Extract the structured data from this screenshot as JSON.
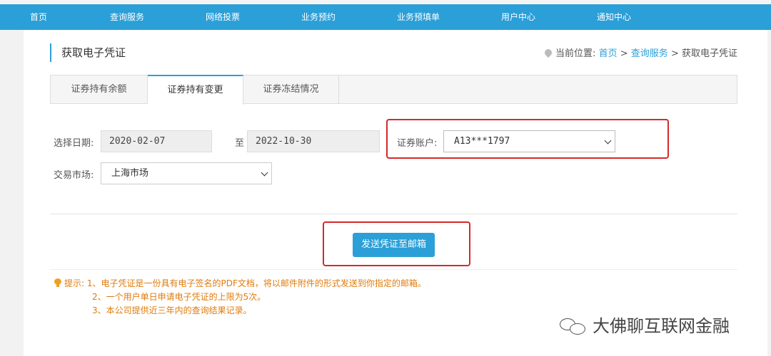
{
  "nav": {
    "items": [
      {
        "label": "首页"
      },
      {
        "label": "查询服务"
      },
      {
        "label": "网络投票"
      },
      {
        "label": "业务预约"
      },
      {
        "label": "业务预填单"
      },
      {
        "label": "用户中心"
      },
      {
        "label": "通知中心"
      }
    ]
  },
  "page": {
    "title": "获取电子凭证"
  },
  "breadcrumb": {
    "prefix": "当前位置:",
    "items": [
      "首页",
      "查询服务",
      "获取电子凭证"
    ],
    "separator": ">"
  },
  "tabs": [
    {
      "label": "证券持有余额",
      "active": false
    },
    {
      "label": "证券持有变更",
      "active": true
    },
    {
      "label": "证券冻结情况",
      "active": false
    }
  ],
  "form": {
    "date_label": "选择日期:",
    "date_start": "2020-02-07",
    "date_to": "至",
    "date_end": "2022-10-30",
    "account_label": "证券账户:",
    "account_value": "A13***1797",
    "market_label": "交易市场:",
    "market_value": "上海市场"
  },
  "actions": {
    "send_label": "发送凭证至邮箱"
  },
  "tips": {
    "heading": "提示:",
    "items": [
      "1、电子凭证是一份具有电子签名的PDF文档，将以邮件附件的形式发送到你指定的邮箱。",
      "2、一个用户单日申请电子凭证的上限为5次。",
      "3、本公司提供近三年内的查询结果记录。"
    ]
  },
  "watermark": {
    "text": "大佛聊互联网金融"
  },
  "colors": {
    "nav_bg": "#2b9fd8",
    "accent": "#2b9fd8",
    "highlight_box": "#d42a2a",
    "tip_text": "#e07b0b"
  }
}
